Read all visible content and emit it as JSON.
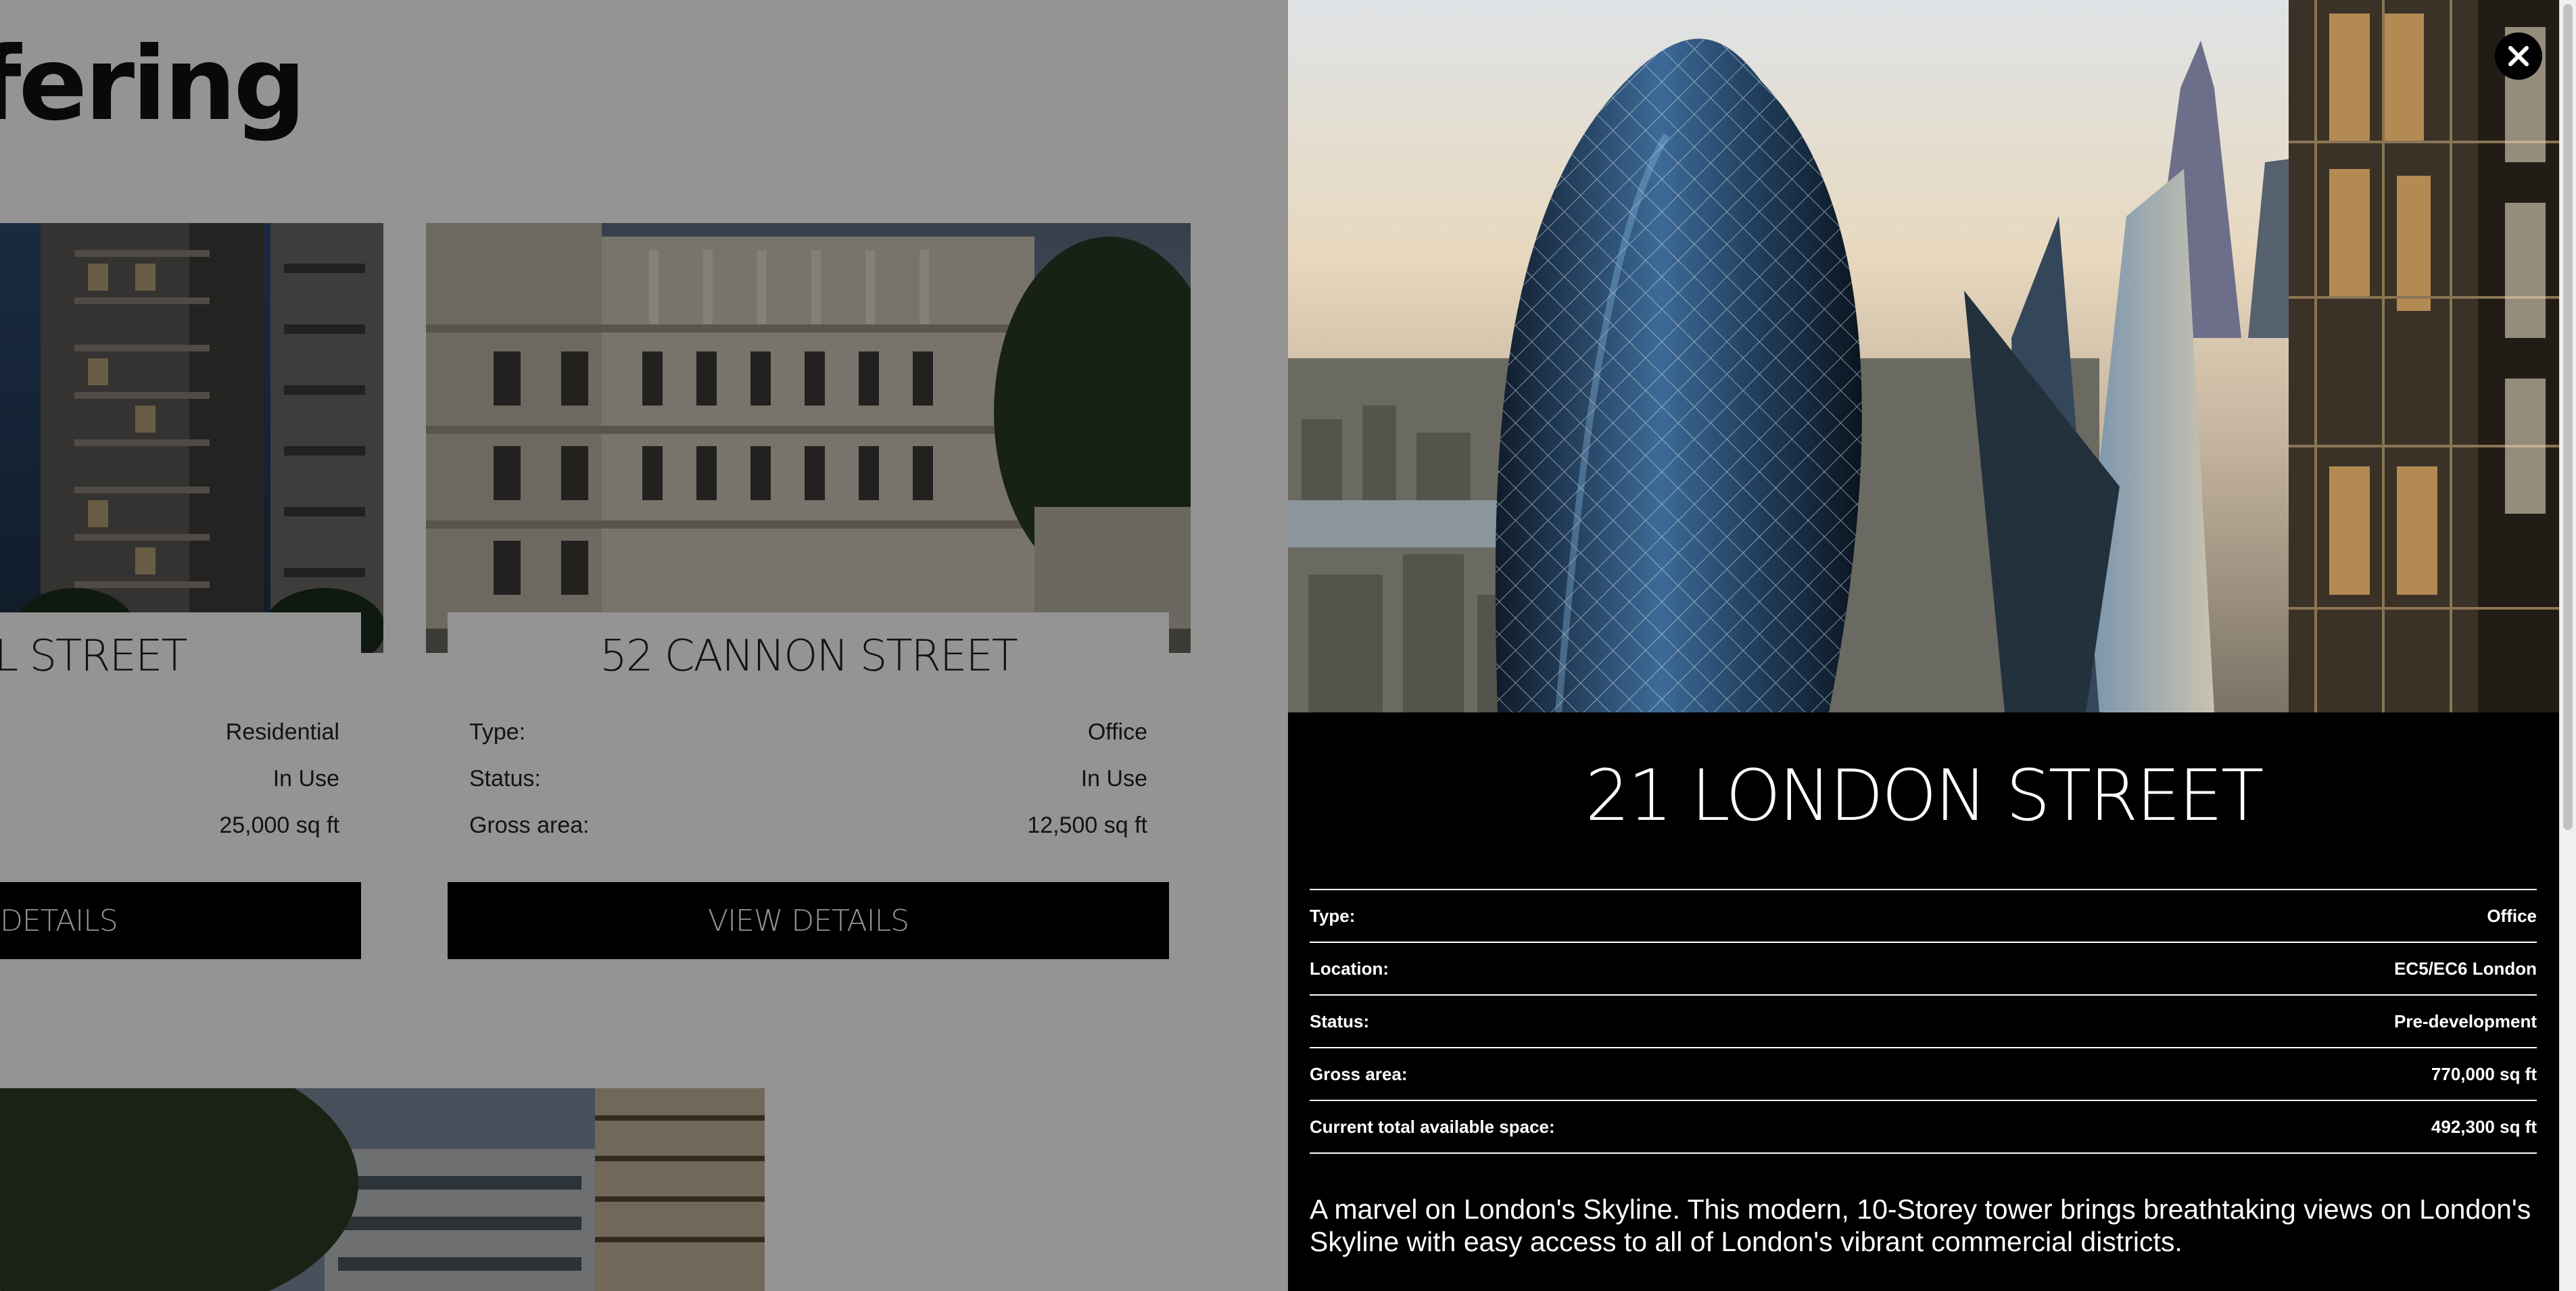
{
  "page": {
    "heading": "ffering",
    "cards": [
      {
        "title": "ALL STREET",
        "rows": [
          {
            "label": "",
            "value": "Residential"
          },
          {
            "label": "",
            "value": "In Use"
          },
          {
            "label": "",
            "value": "25,000 sq ft"
          }
        ],
        "button": "DETAILS"
      },
      {
        "title": "52 CANNON STREET",
        "rows": [
          {
            "label": "Type:",
            "value": "Office"
          },
          {
            "label": "Status:",
            "value": "In Use"
          },
          {
            "label": "Gross area:",
            "value": "12,500 sq ft"
          }
        ],
        "button": "VIEW DETAILS"
      }
    ]
  },
  "modal": {
    "title": "21 LONDON STREET",
    "close_icon": "close-icon",
    "details": [
      {
        "label": "Type:",
        "value": "Office"
      },
      {
        "label": "Location:",
        "value": "EC5/EC6 London"
      },
      {
        "label": "Status:",
        "value": "Pre-development"
      },
      {
        "label": "Gross area:",
        "value": "770,000 sq ft"
      },
      {
        "label": "Current total available space:",
        "value": "492,300 sq ft"
      }
    ],
    "description": "A marvel on London's Skyline. This modern, 10-Storey tower brings breathtaking views on London's Skyline with easy access to all of London's vibrant commercial districts."
  },
  "colors": {
    "modal_bg": "#000000",
    "button_bg": "#000000",
    "overlay": "rgba(0,0,0,0.42)"
  }
}
